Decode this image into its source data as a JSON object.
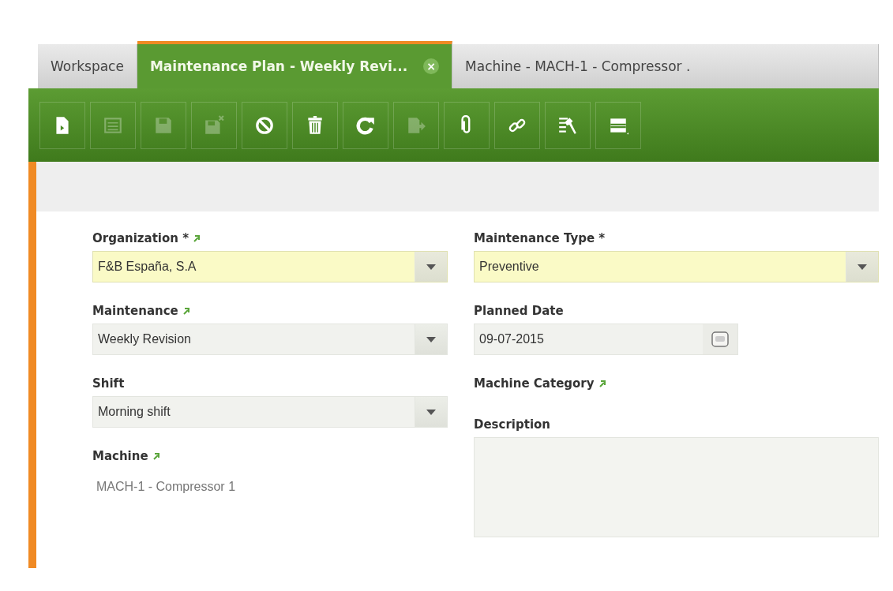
{
  "tabs": [
    {
      "label": "Workspace",
      "selected": false,
      "closable": false
    },
    {
      "label": "Maintenance Plan - Weekly Revi...",
      "selected": true,
      "closable": true,
      "close": "×"
    },
    {
      "label": "Machine - MACH-1 - Compressor .",
      "selected": false,
      "closable": false
    }
  ],
  "toolbar": [
    {
      "kind": "new",
      "disabled": false
    },
    {
      "kind": "list",
      "disabled": true
    },
    {
      "kind": "save",
      "disabled": true
    },
    {
      "kind": "save-close",
      "disabled": true
    },
    {
      "kind": "cancel",
      "disabled": false
    },
    {
      "kind": "delete",
      "disabled": false
    },
    {
      "kind": "refresh",
      "disabled": false
    },
    {
      "kind": "export",
      "disabled": true
    },
    {
      "kind": "attach",
      "disabled": false
    },
    {
      "kind": "link",
      "disabled": false
    },
    {
      "kind": "tools",
      "disabled": false
    },
    {
      "kind": "layout",
      "disabled": false
    }
  ],
  "form": {
    "left": [
      {
        "label": "Organization *",
        "linked": true,
        "kind": "combo",
        "value": "F&B España, S.A",
        "required": true
      },
      {
        "label": "Maintenance",
        "linked": true,
        "kind": "combo",
        "value": "Weekly Revision",
        "required": false
      },
      {
        "label": "Shift",
        "linked": false,
        "kind": "combo",
        "value": "Morning shift",
        "required": false
      },
      {
        "label": "Machine",
        "linked": true,
        "kind": "readonly",
        "value": "MACH-1 - Compressor 1"
      }
    ],
    "right": [
      {
        "label": "Maintenance Type *",
        "linked": false,
        "kind": "combo",
        "value": "Preventive",
        "required": true
      },
      {
        "label": "Planned Date",
        "linked": false,
        "kind": "date",
        "value": "09-07-2015",
        "required": false
      },
      {
        "label": "Machine Category",
        "linked": true,
        "kind": "none"
      },
      {
        "label": "Description",
        "linked": false,
        "kind": "textarea"
      }
    ]
  }
}
